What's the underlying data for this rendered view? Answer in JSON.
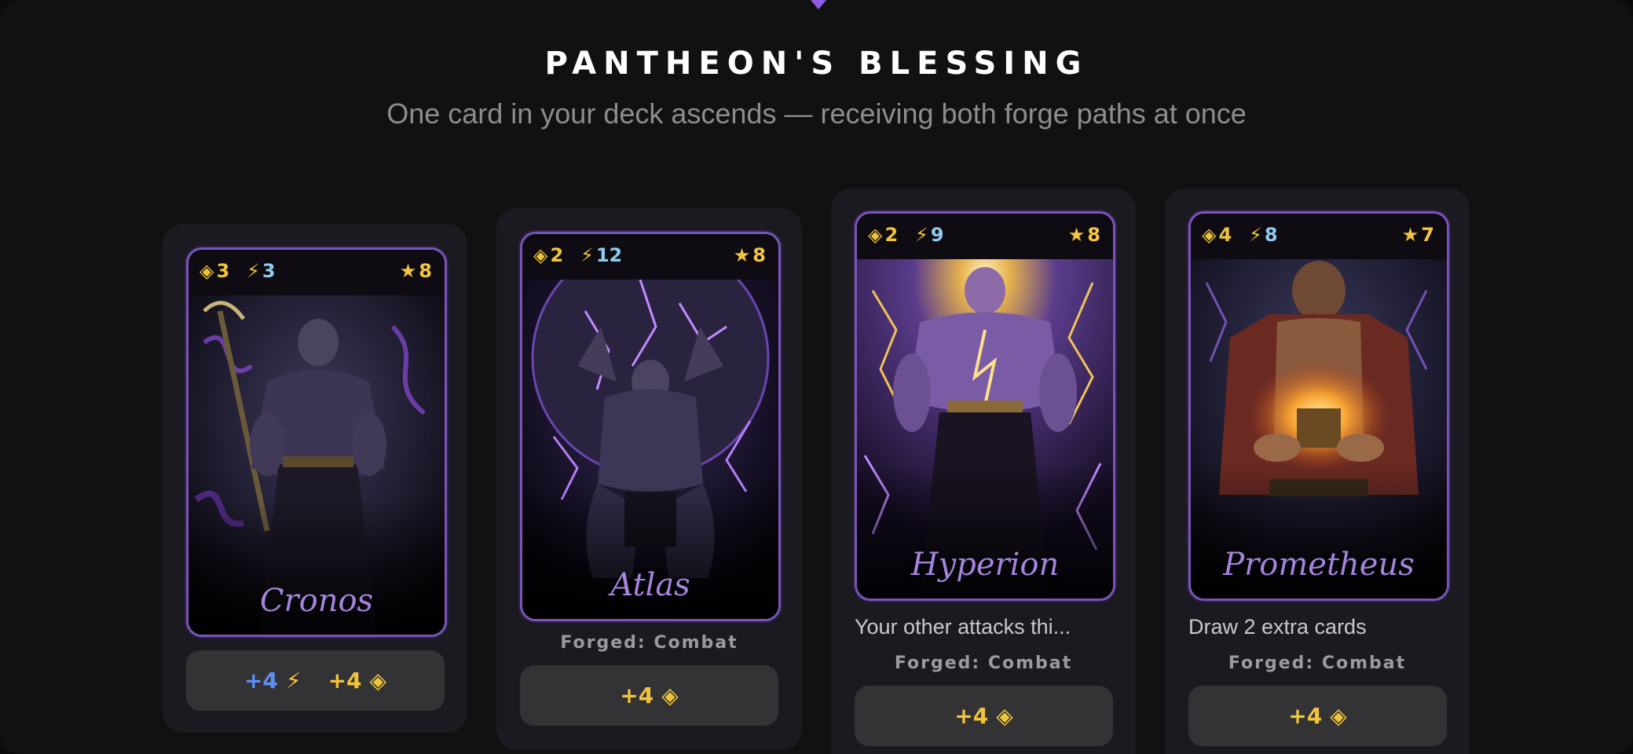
{
  "header": {
    "title": "PANTHEON'S BLESSING",
    "subtitle": "One card in your deck ascends — receiving both forge paths at once"
  },
  "icons": {
    "cost": "◈",
    "power": "⚡",
    "star": "★",
    "cost_color": "#f0c43a",
    "power_color": "#8ecbee",
    "accent": "#7a55b8"
  },
  "cards": [
    {
      "name": "Cronos",
      "cost": "3",
      "power": "3",
      "stars": "8",
      "description": "",
      "forged": "",
      "upgrade": {
        "power_bonus": "+4",
        "cost_bonus": "+4"
      }
    },
    {
      "name": "Atlas",
      "cost": "2",
      "power": "12",
      "stars": "8",
      "description": "",
      "forged": "Forged: Combat",
      "upgrade": {
        "cost_bonus": "+4"
      }
    },
    {
      "name": "Hyperion",
      "cost": "2",
      "power": "9",
      "stars": "8",
      "description": "Your other attacks thi...",
      "forged": "Forged: Combat",
      "upgrade": {
        "cost_bonus": "+4"
      }
    },
    {
      "name": "Prometheus",
      "cost": "4",
      "power": "8",
      "stars": "7",
      "description": "Draw 2 extra cards",
      "forged": "Forged: Combat",
      "upgrade": {
        "cost_bonus": "+4"
      }
    }
  ]
}
